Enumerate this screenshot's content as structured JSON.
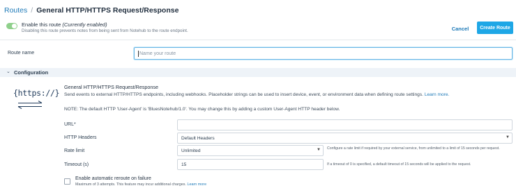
{
  "breadcrumb": {
    "parent": "Routes",
    "separator": "/",
    "current": "General HTTP/HTTPS Request/Response"
  },
  "enable": {
    "title": "Enable this route",
    "status": "(Currently enabled)",
    "description": "Disabling this route prevents notes from being sent from Notehub to the route endpoint.",
    "enabled": true,
    "toggle_color": "#8fd08b"
  },
  "actions": {
    "cancel_label": "Cancel",
    "create_label": "Create Route",
    "create_color": "#1ea7e6"
  },
  "route_name": {
    "label": "Route name",
    "placeholder": "Name your route",
    "value": ""
  },
  "configuration": {
    "header": "Configuration",
    "icon_text": "{https://}",
    "title": "General HTTP/HTTPS Request/Response",
    "description": "Send events to external HTTP/HTTPS endpoints, including webhooks. Placeholder strings can be used to insert device, event, or environment data when defining route settings.",
    "learn_more": "Learn more.",
    "note": "NOTE: The default HTTP 'User-Agent' is 'BluesNotehub/1.0'. You may change this by adding a custom User-Agent HTTP header below."
  },
  "fields": {
    "url": {
      "label": "URL*",
      "value": ""
    },
    "http_headers": {
      "label": "HTTP Headers",
      "value": "Default Headers"
    },
    "rate_limit": {
      "label": "Rate limit",
      "value": "Unlimited",
      "hint": "Configure a rate limit if required by your external service, from unlimited to a limit of 15 seconds per request."
    },
    "timeout": {
      "label": "Timeout (s)",
      "value": "15",
      "hint": "If a timeout of 0 is specified, a default timeout of 15 seconds will be applied to the request."
    }
  },
  "reroute": {
    "title": "Enable automatic reroute on failure",
    "description": "Maximum of 3 attempts. This feature may incur additional charges.",
    "learn_more": "Learn more",
    "checked": false
  }
}
